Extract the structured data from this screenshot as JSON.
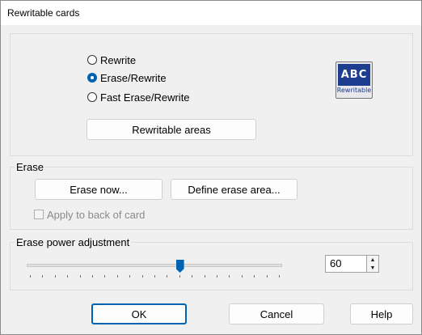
{
  "window": {
    "title": "Rewritable cards"
  },
  "mode": {
    "options": [
      {
        "label": "Rewrite",
        "checked": false
      },
      {
        "label": "Erase/Rewrite",
        "checked": true
      },
      {
        "label": "Fast Erase/Rewrite",
        "checked": false
      }
    ],
    "areas_button": "Rewritable areas",
    "badge": {
      "top_text": "ABC",
      "bottom_text": "Rewritable"
    }
  },
  "erase": {
    "group_label": "Erase",
    "erase_now": "Erase now...",
    "define_area": "Define erase area...",
    "apply_back_label": "Apply to back of card",
    "apply_back_checked": false,
    "apply_back_enabled": false
  },
  "power": {
    "group_label": "Erase power adjustment",
    "value": "60",
    "slider_fraction": 0.6,
    "tick_count": 21
  },
  "footer": {
    "ok": "OK",
    "cancel": "Cancel",
    "help": "Help"
  },
  "colors": {
    "accent": "#0063b1",
    "badge_blue": "#1d3d8f"
  }
}
